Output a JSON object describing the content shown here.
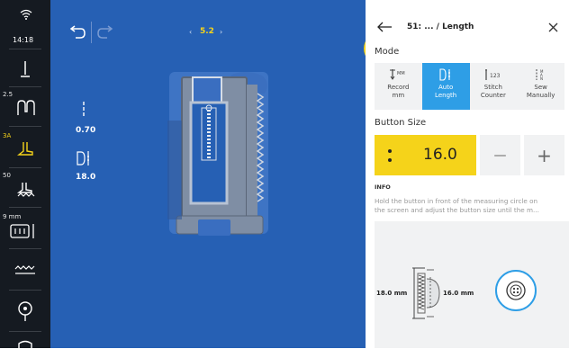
{
  "sidebar": {
    "time": "14:18",
    "items": [
      {
        "label": ""
      },
      {
        "label": "2.5"
      },
      {
        "label": "3A"
      },
      {
        "label": "50"
      },
      {
        "label": "9 mm"
      }
    ]
  },
  "canvas": {
    "stitch_number": "5.2",
    "stitch_width": "0.70",
    "button_size": "18.0"
  },
  "panel": {
    "breadcrumb": "51: ... / Length",
    "mode_title": "Mode",
    "modes": [
      {
        "label": "Record mm",
        "line1": "Record",
        "line2": "mm",
        "active": false
      },
      {
        "label": "Auto Length",
        "line1": "Auto",
        "line2": "Length",
        "active": true
      },
      {
        "label": "Stitch Counter",
        "line1": "Stitch",
        "line2": "Counter",
        "active": false
      },
      {
        "label": "Sew Manually",
        "line1": "Sew",
        "line2": "Manually",
        "active": false
      }
    ],
    "button_size_title": "Button Size",
    "button_size_value": "16.0",
    "minus": "—",
    "plus": "+",
    "info_title": "INFO",
    "info_line1": "Hold the button in front of the measuring circle on",
    "info_line2": "the screen and adjust the button size until the m...",
    "diagram_left": "18.0 mm",
    "diagram_right": "16.0 mm"
  },
  "colors": {
    "accent_yellow": "#f5d31a",
    "accent_blue": "#2e9ee6",
    "canvas_blue": "#2660b4",
    "sidebar_dark": "#151a21"
  }
}
